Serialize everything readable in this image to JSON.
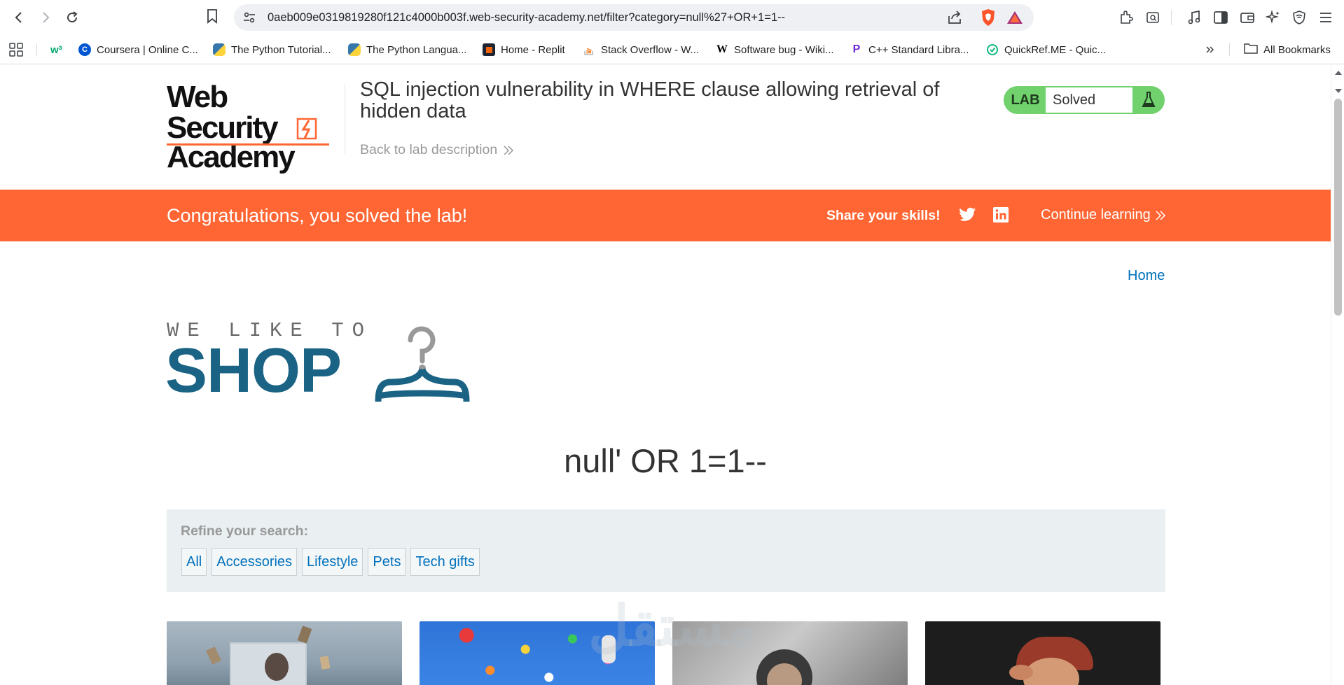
{
  "browser": {
    "url": "0aeb009e0319819280f121c4000b003f.web-security-academy.net/filter?category=null%27+OR+1=1--",
    "bookmarks": [
      {
        "label": "Coursera | Online C...",
        "icon": "coursera-icon",
        "color": "#0056d2"
      },
      {
        "label": "The Python Tutorial...",
        "icon": "python-icon",
        "color": "#3776ab"
      },
      {
        "label": "The Python Langua...",
        "icon": "python-icon",
        "color": "#3776ab"
      },
      {
        "label": "Home - Replit",
        "icon": "replit-icon",
        "color": "#1c2333"
      },
      {
        "label": "Stack Overflow - W...",
        "icon": "stackoverflow-icon",
        "color": "#f48024"
      },
      {
        "label": "Software bug - Wiki...",
        "icon": "wikipedia-icon",
        "color": "#000000"
      },
      {
        "label": "C++ Standard Libra...",
        "icon": "cpp-icon",
        "color": "#6d28d9"
      },
      {
        "label": "QuickRef.ME - Quic...",
        "icon": "quickref-icon",
        "color": "#10b981"
      }
    ],
    "all_bookmarks": "All Bookmarks",
    "w3_label": "w³"
  },
  "header": {
    "logo_line1": "Web Security",
    "logo_line2": "Academy",
    "lab_title": "SQL injection vulnerability in WHERE clause allowing retrieval of hidden data",
    "back_link": "Back to lab description",
    "badge_lab": "LAB",
    "badge_state": "Solved",
    "accent": "#ff6633",
    "solved_green": "#70d16d"
  },
  "banner": {
    "message": "Congratulations, you solved the lab!",
    "share": "Share your skills!",
    "continue": "Continue learning"
  },
  "shop": {
    "home": "Home",
    "tagline": "WE LIKE TO",
    "brand": "SHOP",
    "query_title": "null' OR 1=1--",
    "refine_label": "Refine your search:",
    "filters": [
      "All",
      "Accessories",
      "Lifestyle",
      "Pets",
      "Tech gifts"
    ]
  },
  "watermark": "مستقل"
}
